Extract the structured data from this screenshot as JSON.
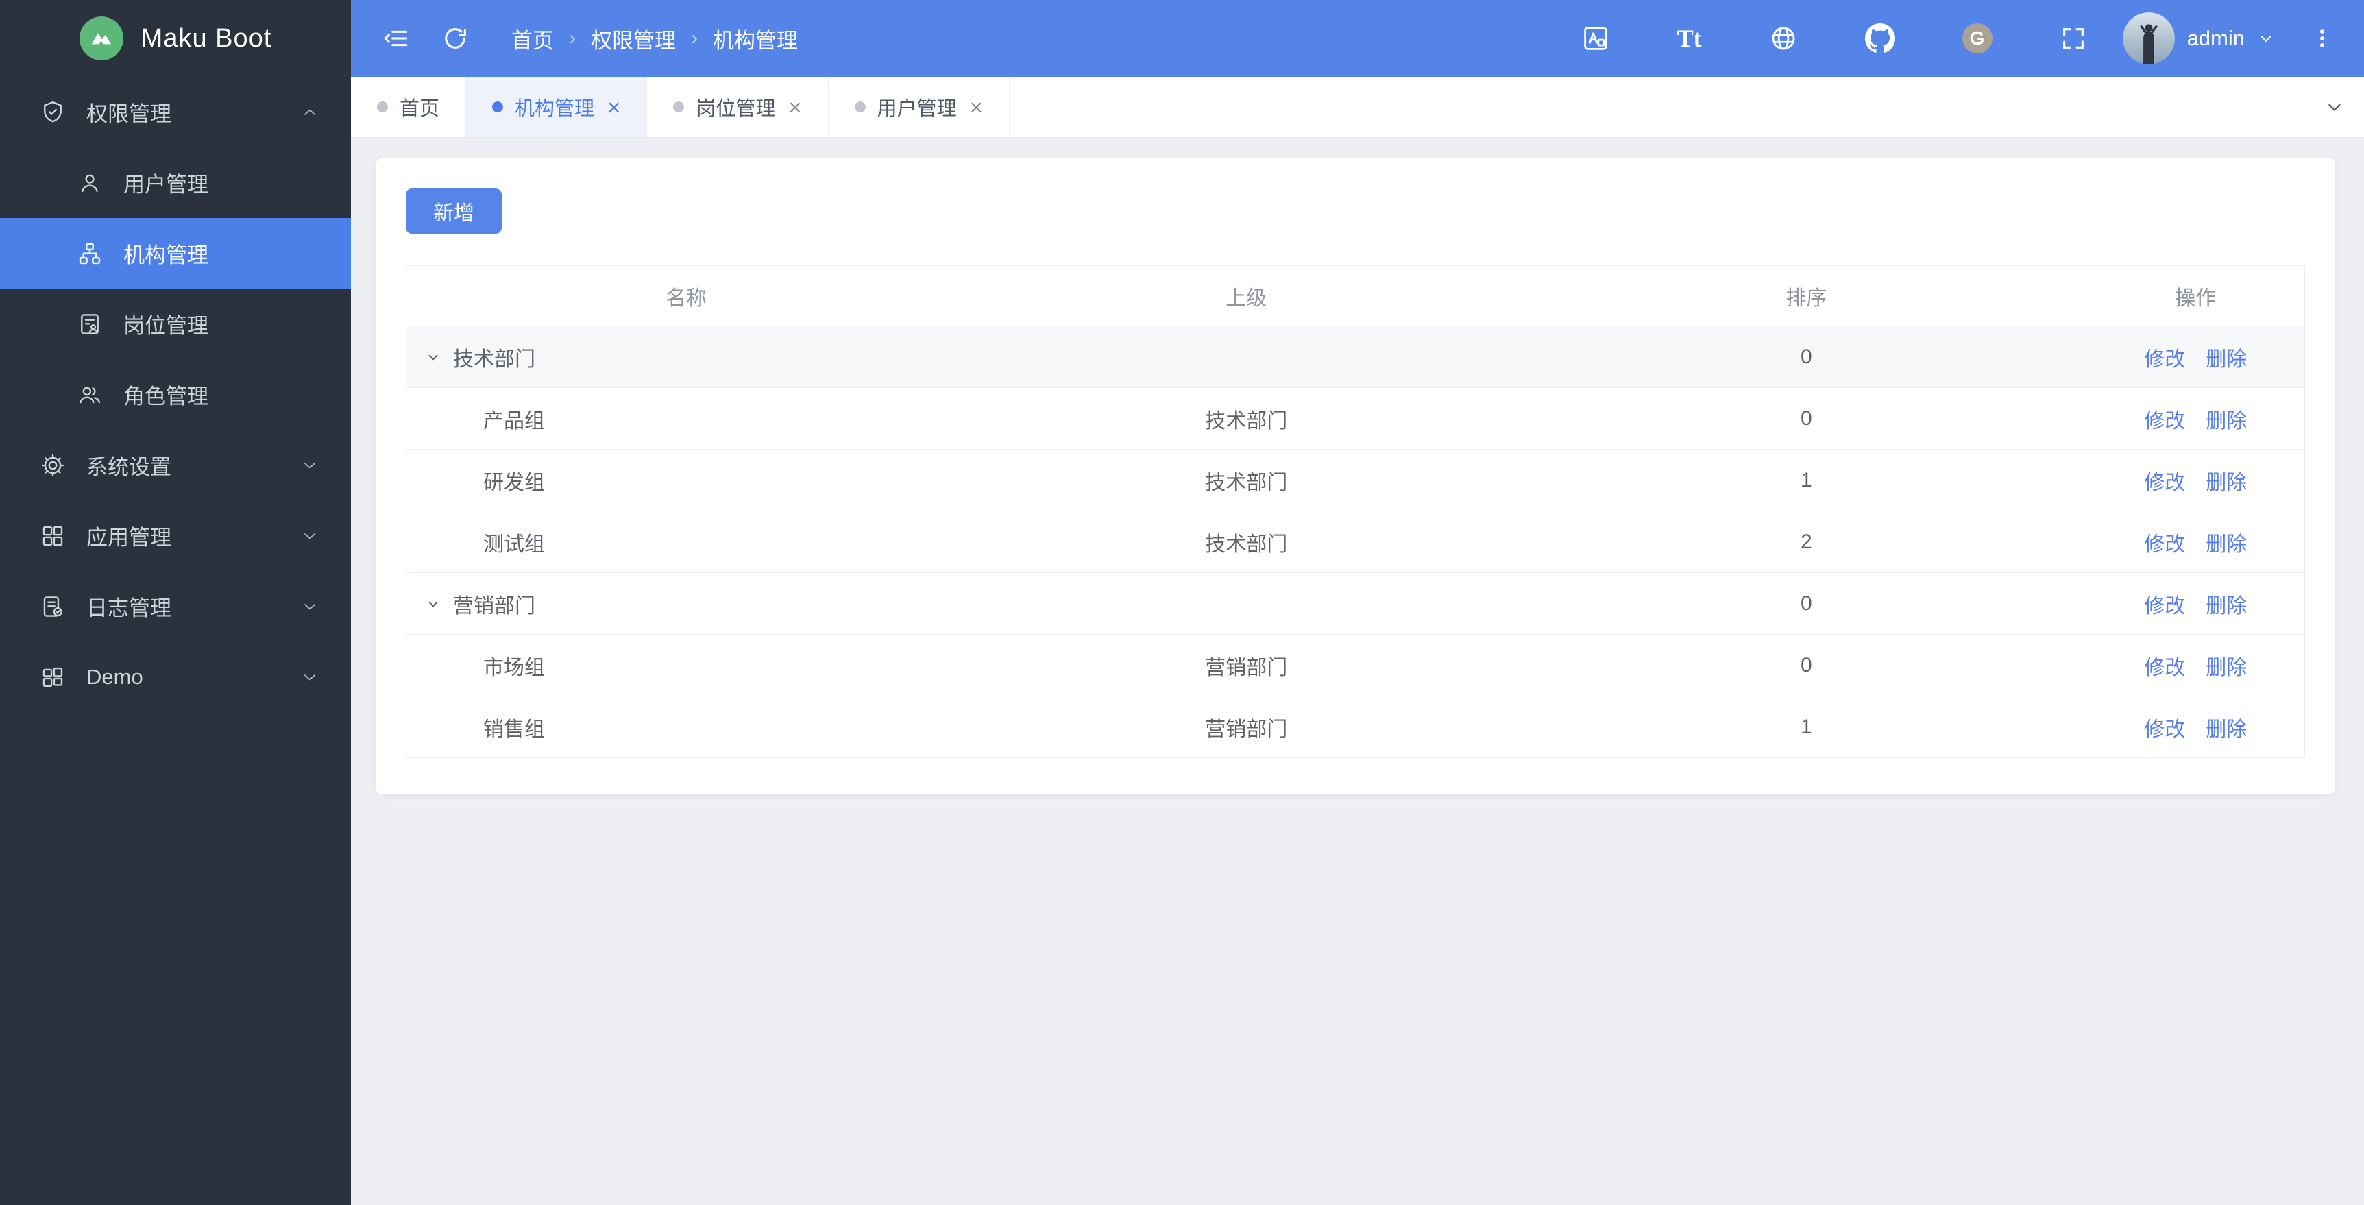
{
  "app": {
    "name": "Maku Boot"
  },
  "colors": {
    "primary": "#5584e8",
    "sidebar_bg": "#2a333d",
    "sidebar_active": "#4c80e8",
    "page_bg": "#edeff4",
    "link": "#5a7fe8",
    "border": "#ebeef5",
    "cell_text": "#5f6368",
    "th_text": "#8f949e",
    "tab_active_bg": "#edf2fb",
    "tab_active_text": "#4c7ce9",
    "dot": "#c0c4cc",
    "row_highlight": "#f7f8fa",
    "logo_green": "#5bb879",
    "button_bg": "#5585e8"
  },
  "sidebar": {
    "menu": [
      {
        "label": "权限管理",
        "icon": "shield-icon",
        "expanded": true,
        "children": [
          {
            "label": "用户管理",
            "icon": "user-icon",
            "active": false
          },
          {
            "label": "机构管理",
            "icon": "org-icon",
            "active": true
          },
          {
            "label": "岗位管理",
            "icon": "post-icon",
            "active": false
          },
          {
            "label": "角色管理",
            "icon": "roles-icon",
            "active": false
          }
        ]
      },
      {
        "label": "系统设置",
        "icon": "gear-icon",
        "expanded": false,
        "children": []
      },
      {
        "label": "应用管理",
        "icon": "apps-icon",
        "expanded": false,
        "children": []
      },
      {
        "label": "日志管理",
        "icon": "log-icon",
        "expanded": false,
        "children": []
      },
      {
        "label": "Demo",
        "icon": "demo-icon",
        "expanded": false,
        "children": []
      }
    ]
  },
  "topbar": {
    "breadcrumb": [
      "首页",
      "权限管理",
      "机构管理"
    ],
    "separator": "›",
    "right_icons": [
      "translate-icon",
      "font-size-icon",
      "globe-icon",
      "github-icon",
      "gitee-icon",
      "fullscreen-icon",
      "kebab-menu-icon"
    ],
    "user": {
      "name": "admin"
    }
  },
  "tabbar": {
    "tabs": [
      {
        "label": "首页",
        "active": false,
        "closable": false
      },
      {
        "label": "机构管理",
        "active": true,
        "closable": true
      },
      {
        "label": "岗位管理",
        "active": false,
        "closable": true
      },
      {
        "label": "用户管理",
        "active": false,
        "closable": true
      }
    ]
  },
  "page": {
    "add_button": "新增",
    "table": {
      "columns": [
        "名称",
        "上级",
        "排序",
        "操作"
      ],
      "actions": {
        "edit": "修改",
        "delete": "删除"
      },
      "rows": [
        {
          "name": "技术部门",
          "parent": "",
          "sort": "0",
          "level": 0,
          "expanded": true,
          "highlight": true
        },
        {
          "name": "产品组",
          "parent": "技术部门",
          "sort": "0",
          "level": 1
        },
        {
          "name": "研发组",
          "parent": "技术部门",
          "sort": "1",
          "level": 1
        },
        {
          "name": "测试组",
          "parent": "技术部门",
          "sort": "2",
          "level": 1
        },
        {
          "name": "营销部门",
          "parent": "",
          "sort": "0",
          "level": 0,
          "expanded": true
        },
        {
          "name": "市场组",
          "parent": "营销部门",
          "sort": "0",
          "level": 1
        },
        {
          "name": "销售组",
          "parent": "营销部门",
          "sort": "1",
          "level": 1
        }
      ]
    }
  }
}
